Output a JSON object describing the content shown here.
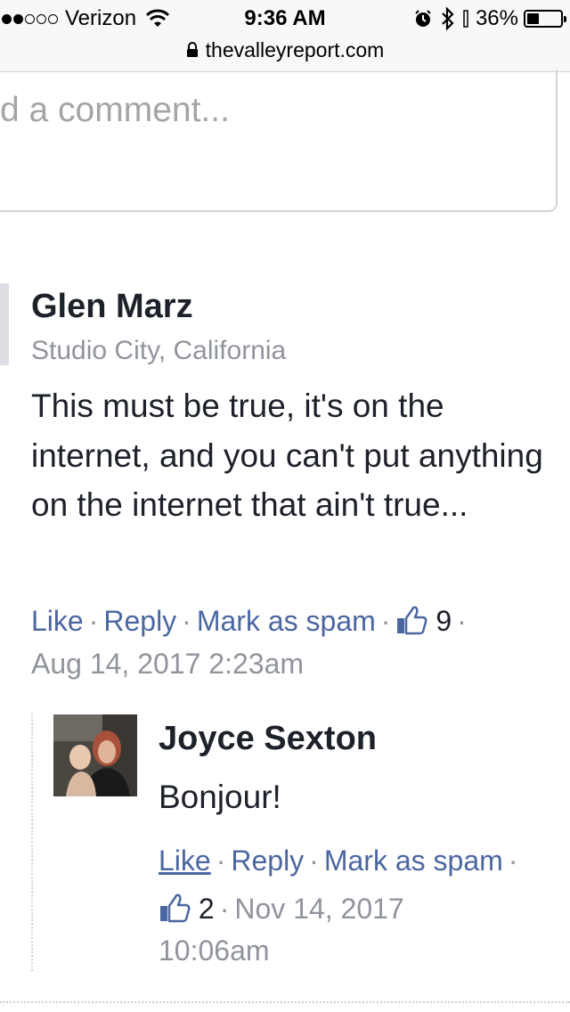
{
  "status_bar": {
    "carrier": "Verizon",
    "time": "9:36 AM",
    "battery_percent": "36%",
    "battery_level": 0.36,
    "url": "thevalleyreport.com"
  },
  "comment_input": {
    "placeholder": "d a comment..."
  },
  "comments": [
    {
      "author": "Glen Marz",
      "location": "Studio City, California",
      "text": "This must be true, it's on the internet, and you can't put anything on the internet that ain't true...",
      "like_label": "Like",
      "reply_label": "Reply",
      "spam_label": "Mark as spam",
      "like_count": "9",
      "timestamp": "Aug 14, 2017 2:23am"
    },
    {
      "author": "Joyce Sexton",
      "text": "Bonjour!",
      "like_label": "Like",
      "reply_label": "Reply",
      "spam_label": "Mark as spam",
      "like_count": "2",
      "timestamp_line1": "Nov 14, 2017",
      "timestamp_line2": "10:06am"
    }
  ],
  "colors": {
    "link": "#4b67a1",
    "meta": "#90949c",
    "text": "#1d2129"
  }
}
